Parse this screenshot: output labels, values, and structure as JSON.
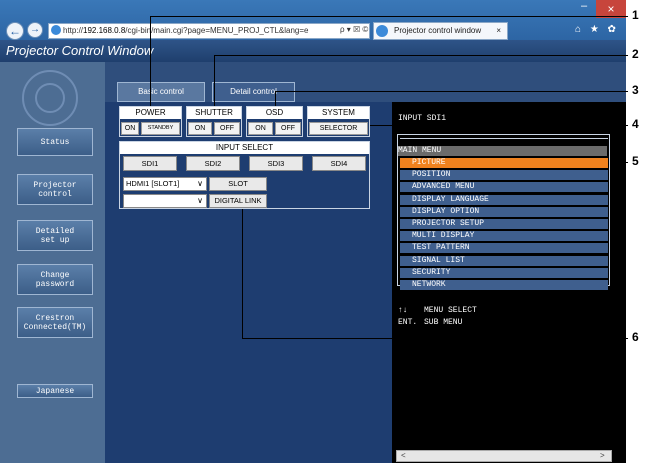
{
  "browser": {
    "address_prefix": "http://",
    "address_host": "192.168.0.8",
    "address_rest": "/cgi-bin/main.cgi?page=MENU_PROJ_CTL&lang=e",
    "address_tools": "ρ ▾ ☒ ©",
    "tab_title": "Projector control window",
    "tab_close": "×",
    "toolbar_icons": "⌂ ★ ✿",
    "win_minimize": "–",
    "win_close": "×"
  },
  "window_title": "Projector Control Window",
  "tabs": [
    {
      "label": "Basic control"
    },
    {
      "label": "Detail control"
    }
  ],
  "sidebar": {
    "items": [
      {
        "label": "Status"
      },
      {
        "label": "Projector\ncontrol"
      },
      {
        "label": "Detailed\nset up"
      },
      {
        "label": "Change\npassword"
      },
      {
        "label": "Crestron\nConnected(TM)"
      },
      {
        "label": "Japanese"
      }
    ]
  },
  "controls": {
    "power": {
      "title": "POWER",
      "on": "ON",
      "standby": "STANDBY"
    },
    "shutter": {
      "title": "SHUTTER",
      "on": "ON",
      "off": "OFF"
    },
    "osd": {
      "title": "OSD",
      "on": "ON",
      "off": "OFF"
    },
    "system": {
      "title": "SYSTEM",
      "selector": "SELECTOR"
    },
    "input_select": {
      "title": "INPUT SELECT",
      "buttons": [
        "SDI1",
        "SDI2",
        "SDI3",
        "SDI4"
      ],
      "slot_value": "HDMI1 [SLOT1]",
      "slot_button": "SLOT",
      "digital_link_value": "",
      "digital_link_button": "DIGITAL LINK"
    }
  },
  "osd": {
    "input": "INPUT SDI1",
    "menu_header": "MAIN MENU",
    "items": [
      "PICTURE",
      "POSITION",
      "ADVANCED MENU",
      "DISPLAY LANGUAGE",
      "DISPLAY OPTION",
      "PROJECTOR SETUP",
      "MULTI DISPLAY",
      "TEST PATTERN",
      "SIGNAL LIST",
      "SECURITY",
      "NETWORK"
    ],
    "selected_index": 0,
    "hint_arrows": "↑↓",
    "hint_select": "MENU SELECT",
    "hint_ent": "ENT.",
    "hint_sub": "SUB MENU"
  },
  "callouts": [
    "1",
    "2",
    "3",
    "4",
    "5",
    "6"
  ],
  "colors": {
    "selected_item": "#f0821e",
    "menu_item": "#3f5f8e"
  }
}
